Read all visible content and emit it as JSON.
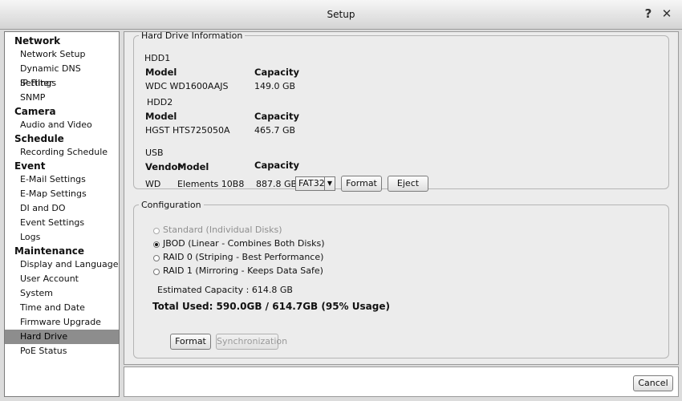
{
  "window": {
    "title": "Setup"
  },
  "sidebar": {
    "sections": [
      {
        "label": "Network",
        "items": [
          "Network Setup",
          "Dynamic DNS Settings",
          "IP Filter",
          "SNMP"
        ]
      },
      {
        "label": "Camera",
        "items": [
          "Audio and Video"
        ]
      },
      {
        "label": "Schedule",
        "items": [
          "Recording Schedule"
        ]
      },
      {
        "label": "Event",
        "items": [
          "E-Mail Settings",
          "E-Map Settings",
          "DI and DO",
          "Event Settings",
          "Logs"
        ]
      },
      {
        "label": "Maintenance",
        "items": [
          "Display and Language",
          "User Account",
          "System",
          "Time and Date",
          "Firmware Upgrade",
          "Hard Drive",
          "PoE Status"
        ]
      }
    ],
    "selected": "Hard Drive"
  },
  "hdd_info": {
    "legend": "Hard Drive Information",
    "hdd1": {
      "label": "HDD1",
      "model_header": "Model",
      "capacity_header": "Capacity",
      "model": "WDC WD1600AAJS",
      "capacity": "149.0 GB"
    },
    "hdd2": {
      "label": "HDD2",
      "model_header": "Model",
      "capacity_header": "Capacity",
      "model": "HGST HTS725050A",
      "capacity": "465.7 GB"
    },
    "usb": {
      "label": "USB",
      "vendor_header": "Vendor",
      "model_header": "Model",
      "capacity_header": "Capacity",
      "vendor": "WD",
      "model": "Elements 10B8",
      "capacity": "887.8 GB",
      "fs_value": "FAT32",
      "format_label": "Format",
      "eject_label": "Eject"
    }
  },
  "config": {
    "legend": "Configuration",
    "options": [
      {
        "label": "Standard (Individual Disks)",
        "checked": false,
        "disabled": true
      },
      {
        "label": "JBOD (Linear - Combines Both Disks)",
        "checked": true,
        "disabled": false
      },
      {
        "label": "RAID 0 (Striping - Best Performance)",
        "checked": false,
        "disabled": false
      },
      {
        "label": "RAID 1 (Mirroring - Keeps Data Safe)",
        "checked": false,
        "disabled": false
      }
    ],
    "estimated_capacity": "Estimated Capacity : 614.8 GB",
    "total_used": "Total Used: 590.0GB / 614.7GB (95% Usage)",
    "format_label": "Format",
    "sync_label": "Synchronization"
  },
  "footer": {
    "cancel_label": "Cancel"
  },
  "icons": {
    "help": "help-icon",
    "close": "close-icon",
    "dropdown": "chevron-down-icon"
  }
}
